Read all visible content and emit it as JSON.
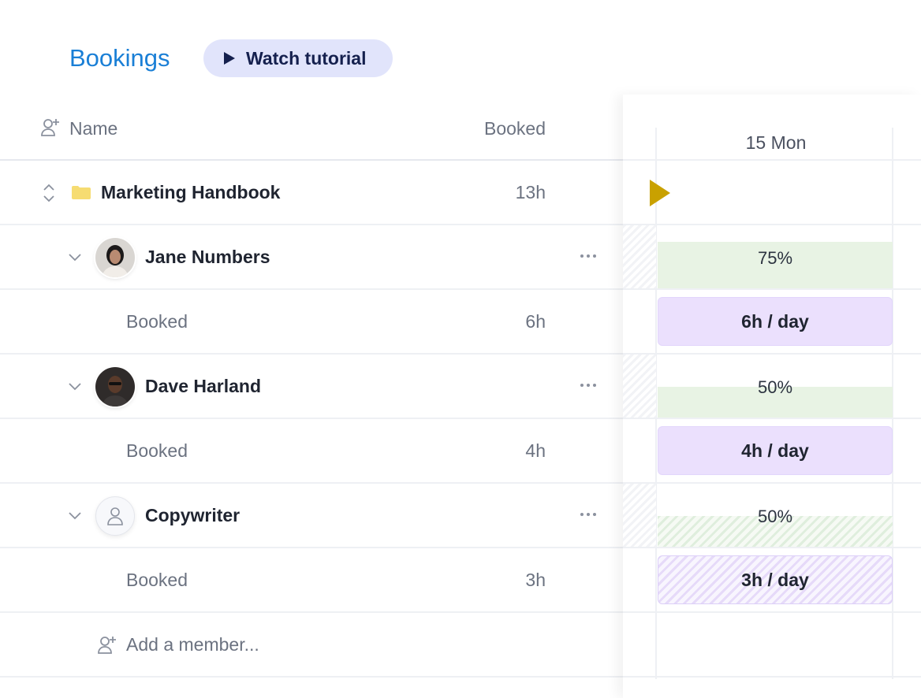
{
  "header": {
    "title": "Bookings",
    "tutorial_label": "Watch tutorial"
  },
  "table": {
    "columns": {
      "name": "Name",
      "booked": "Booked"
    },
    "project": {
      "name": "Marketing Handbook",
      "hours": "13h",
      "icon": "folder-icon"
    },
    "members": [
      {
        "name": "Jane Numbers",
        "avatar": "photo",
        "booked_label": "Booked",
        "booked_hours": "6h",
        "capacity": "75%",
        "capacity_fraction": 0.75,
        "rate": "6h / day",
        "tentative": false
      },
      {
        "name": "Dave Harland",
        "avatar": "photo",
        "booked_label": "Booked",
        "booked_hours": "4h",
        "capacity": "50%",
        "capacity_fraction": 0.5,
        "rate": "4h / day",
        "tentative": false
      },
      {
        "name": "Copywriter",
        "avatar": "placeholder",
        "booked_label": "Booked",
        "booked_hours": "3h",
        "capacity": "50%",
        "capacity_fraction": 0.5,
        "rate": "3h / day",
        "tentative": true
      }
    ],
    "add_member_label": "Add a member..."
  },
  "timeline": {
    "day_label": "15 Mon",
    "colors": {
      "capacity": "#e8f3e4",
      "booking": "#ebe0fd",
      "flag": "#c9a100",
      "link": "#1a7fd6"
    }
  }
}
